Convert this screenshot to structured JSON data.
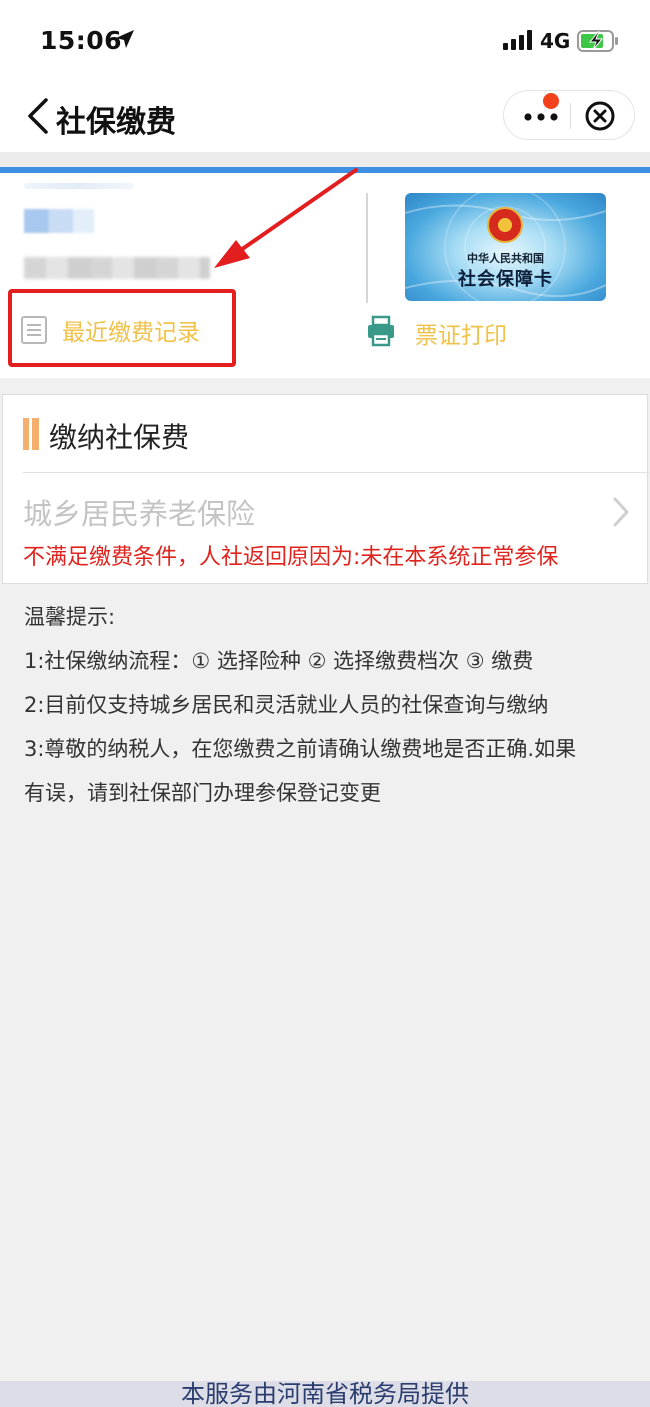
{
  "status_bar": {
    "time": "15:06",
    "network": "4G",
    "icons": [
      "location-arrow-icon",
      "signal-bars-icon",
      "battery-charging-icon"
    ]
  },
  "nav": {
    "title": "社保缴费",
    "icons": [
      "back-chevron-icon",
      "more-dots-icon",
      "close-circle-icon"
    ]
  },
  "info_card": {
    "card_image": {
      "small_text": "中华人民共和国",
      "big_text": "社会保障卡"
    },
    "recent_records_label": "最近缴费记录",
    "print_label": "票证打印",
    "link_color": "#f0c24a",
    "accent_blue": "#3f8fe4"
  },
  "pay_section": {
    "title": "缴纳社保费",
    "insurance_name": "城乡居民养老保险",
    "error_text": "不满足缴费条件，人社返回原因为:未在本系统正常参保",
    "error_color": "#e0231d"
  },
  "tips": {
    "heading": "温馨提示:",
    "line1": "1:社保缴纳流程：① 选择险种 ② 选择缴费档次 ③ 缴费",
    "line2": "2:目前仅支持城乡居民和灵活就业人员的社保查询与缴纳",
    "line3a": "3:尊敬的纳税人，在您缴费之前请确认缴费地是否正确.如果",
    "line3b": "有误，请到社保部门办理参保登记变更"
  },
  "footer": {
    "text": "本服务由河南省税务局提供"
  }
}
